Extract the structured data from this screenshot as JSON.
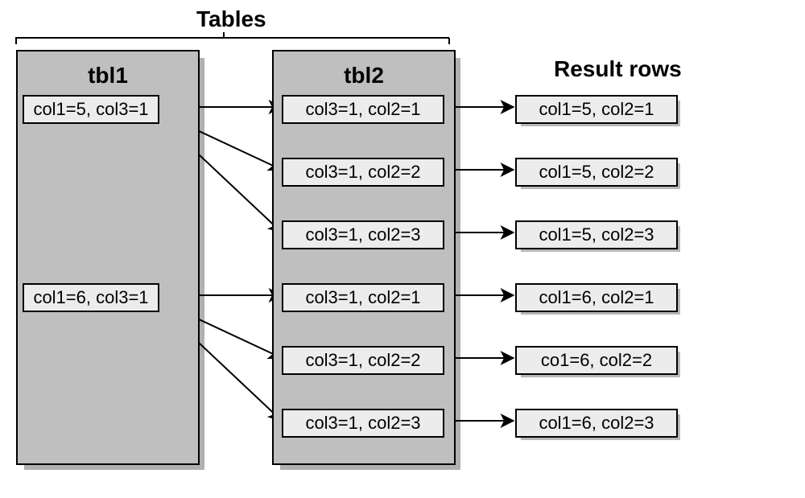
{
  "title_tables": "Tables",
  "title_result": "Result rows",
  "panels": {
    "tbl1": {
      "title": "tbl1"
    },
    "tbl2": {
      "title": "tbl2"
    }
  },
  "tbl1_rows": [
    "col1=5, col3=1",
    "col1=6, col3=1"
  ],
  "tbl2_rows": [
    "col3=1, col2=1",
    "col3=1, col2=2",
    "col3=1, col2=3",
    "col3=1, col2=1",
    "col3=1, col2=2",
    "col3=1, col2=3"
  ],
  "result_rows": [
    "col1=5, col2=1",
    "col1=5, col2=2",
    "col1=5, col2=3",
    "col1=6, col2=1",
    "co1=6, col2=2",
    "col1=6, col2=3"
  ],
  "chart_data": {
    "type": "diagram",
    "description": "Nested-loop join illustration: each row of tbl1 fans out to three rows of tbl2 (matched on col3=1), producing six result rows.",
    "edges": [
      {
        "from": "tbl1[0]",
        "to": "tbl2[0]"
      },
      {
        "from": "tbl1[0]",
        "to": "tbl2[1]"
      },
      {
        "from": "tbl1[0]",
        "to": "tbl2[2]"
      },
      {
        "from": "tbl1[1]",
        "to": "tbl2[3]"
      },
      {
        "from": "tbl1[1]",
        "to": "tbl2[4]"
      },
      {
        "from": "tbl1[1]",
        "to": "tbl2[5]"
      },
      {
        "from": "tbl2[0]",
        "to": "result[0]"
      },
      {
        "from": "tbl2[1]",
        "to": "result[1]"
      },
      {
        "from": "tbl2[2]",
        "to": "result[2]"
      },
      {
        "from": "tbl2[3]",
        "to": "result[3]"
      },
      {
        "from": "tbl2[4]",
        "to": "result[4]"
      },
      {
        "from": "tbl2[5]",
        "to": "result[5]"
      }
    ]
  }
}
